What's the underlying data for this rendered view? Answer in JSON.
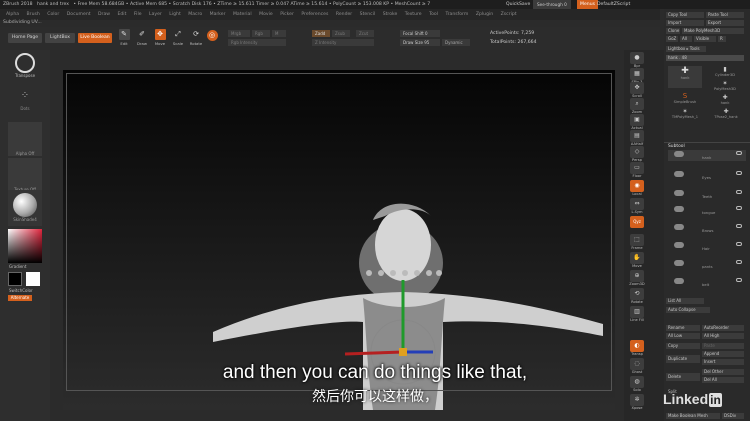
{
  "titlebar": {
    "app": "ZBrush 2018",
    "doc": "hank and trex",
    "stats": "• Free Mem 58.684GB • Active Mem 685 • Scratch Disk 176 • ZTime ≥ 15.611 Timer ≥ 0.047 ATime ≥ 15.614 • PolyCount ≥ 153.008 KP • MeshCount ≥ 7",
    "quicksave": "QuickSave",
    "seethrough": "See-through 0",
    "menus": "Menus",
    "defaultscript": "DefaultZScript"
  },
  "menubar": [
    "Alpha",
    "Brush",
    "Color",
    "Document",
    "Draw",
    "Edit",
    "File",
    "Layer",
    "Light",
    "Macro",
    "Marker",
    "Material",
    "Movie",
    "Picker",
    "Preferences",
    "Render",
    "Stencil",
    "Stroke",
    "Texture",
    "Tool",
    "Transform",
    "Zplugin",
    "Zscript"
  ],
  "docname": "Subdividing UV...",
  "shelf": {
    "home": "Home Page",
    "lightbox": "LightBox",
    "liveboolean": "Live Boolean",
    "edit": "Edit",
    "draw": "Draw",
    "move": "Move",
    "scale": "Scale",
    "rotate": "Rotate",
    "mrgb": "Mrgb",
    "rgb": "Rgb",
    "m": "M",
    "zadd": "Zadd",
    "zsub": "Zsub",
    "zcut": "Zcut",
    "rgb_intensity": "Rgb Intensity",
    "z_intensity": "Z Intensity",
    "focal_shift": "Focal Shift 0",
    "draw_size": "Draw Size 95",
    "dynamic": "Dynamic",
    "active_points": "ActivePoints: 7,259",
    "total_points": "TotalPoints: 267,664"
  },
  "left": {
    "transpose": "Transpose",
    "dots": "Dots",
    "alpha_off": "Alpha Off",
    "texture_off": "Texture Off",
    "skinshade": "SkinShade4",
    "gradient": "Gradient",
    "switchcolor": "SwitchColor",
    "alternate": "Alternate"
  },
  "righttools": [
    "Bpr",
    "SPix 3",
    "Scroll",
    "Zoom",
    "Actual",
    "AAHalf",
    "Persp",
    "Floor",
    "Local",
    "L.Sym",
    "Qyz",
    "Frame",
    "Move",
    "Zoom3D",
    "Rotate",
    "Line Fill",
    "PolyF",
    "Transp",
    "Ghost",
    "Solo",
    "Xpose"
  ],
  "rightpanel": {
    "copy_tool": "Copy Tool",
    "paste_tool": "Paste Tool",
    "import": "Import",
    "export": "Export",
    "clone": "Clone",
    "make_polymesh": "Make PolyMesh3D",
    "goz": "GoZ",
    "all": "All",
    "visible": "Visible",
    "r": "R",
    "lightbox_tools": "Lightbox ▸ Tools",
    "hank_slider": "hank . 48",
    "thumbs": [
      "hank",
      "Cylinder3D",
      "PolyMesh3D",
      "SimpleBrush",
      "hank",
      "TMPolyMesh_1",
      "TPose2_hank"
    ],
    "subtool": "Subtool",
    "subtools": [
      "hank",
      "Eyes",
      "Teeth",
      "tongue",
      "Brows",
      "Hair",
      "pants",
      "belt"
    ],
    "list_all": "List All",
    "auto_collapse": "Auto Collapse",
    "rename": "Rename",
    "autoreorder": "AutoReorder",
    "all_low": "All Low",
    "all_high": "All High",
    "copy": "Copy",
    "paste": "Paste",
    "duplicate": "Duplicate",
    "append": "Append",
    "insert": "Insert",
    "delete": "Delete",
    "del_other": "Del Other",
    "del_all": "Del All",
    "split": "Split",
    "make_boolean_mesh": "Make Boolean Mesh",
    "dsdiv": "DSDiv"
  },
  "subtitle": {
    "en": "and then you can do things like that,",
    "zh": "然后你可以这样做，"
  },
  "watermark": "Linked",
  "watermark_in": "in",
  "colors": {
    "accent": "#d4601d",
    "panel": "#2a2a2a"
  }
}
